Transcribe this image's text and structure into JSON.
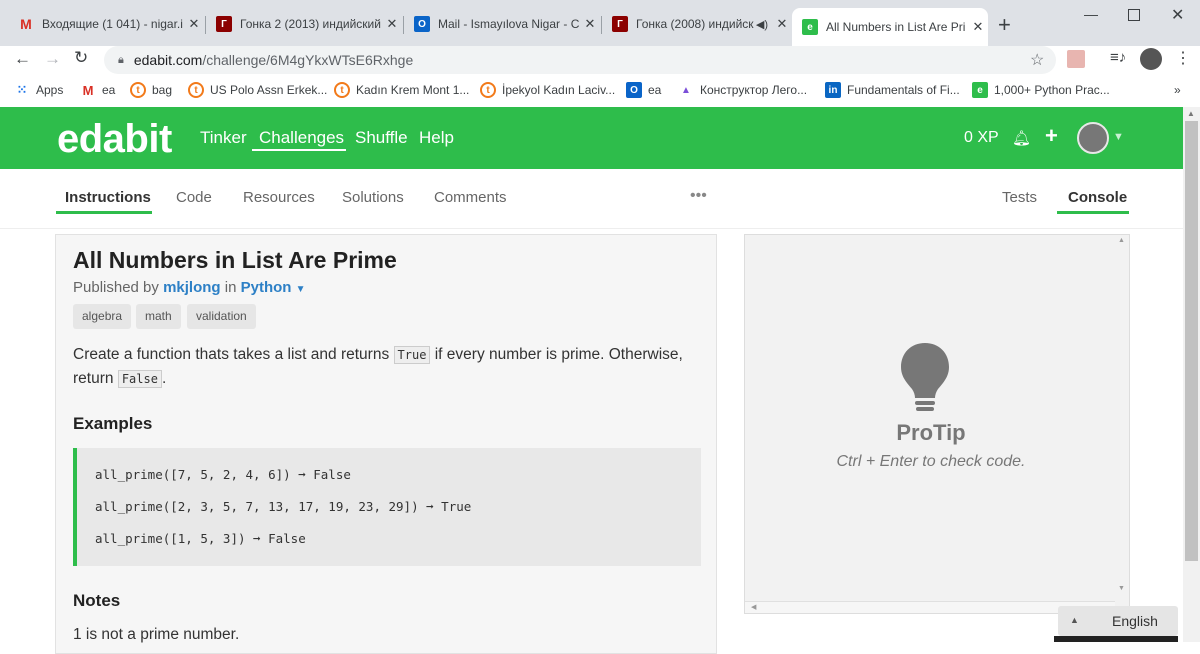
{
  "browser": {
    "tabs": [
      {
        "title": "Входящие (1 041) - nigar.i",
        "icon": "gmail-icon"
      },
      {
        "title": "Гонка 2 (2013) индийский",
        "icon": "movie-icon"
      },
      {
        "title": "Mail - Ismayılova Nigar - C",
        "icon": "outlook-icon"
      },
      {
        "title": "Гонка (2008) индийск",
        "icon": "movie-icon"
      },
      {
        "title": "All Numbers in List Are Pri",
        "icon": "edabit-icon"
      }
    ],
    "url_host": "edabit.com",
    "url_path": "/challenge/6M4gYkxWTsE6Rxhge",
    "bookmarks": [
      "Apps",
      "ea",
      "bag",
      "US Polo Assn Erkek...",
      "Kadın Krem Mont 1...",
      "İpekyol Kadın Laciv...",
      "ea",
      "Конструктор Лего...",
      "Fundamentals of Fi...",
      "1,000+ Python Prac..."
    ],
    "more_bookmarks": "»"
  },
  "site": {
    "logo": "edabit",
    "nav": [
      "Tinker",
      "Challenges",
      "Shuffle",
      "Help"
    ],
    "xp": "0 XP"
  },
  "page_tabs": {
    "left": [
      "Instructions",
      "Code",
      "Resources",
      "Solutions",
      "Comments"
    ],
    "more": "•••",
    "right": [
      "Tests",
      "Console"
    ]
  },
  "challenge": {
    "title": "All Numbers in List Are Prime",
    "published_prefix": "Published by",
    "author": "mkjlong",
    "in_word": "in",
    "language": "Python",
    "tags": [
      "algebra",
      "math",
      "validation"
    ],
    "desc_part1": "Create a function thats takes a list and returns",
    "code_true": "True",
    "desc_part2": "if every number is prime. Otherwise, return",
    "code_false": "False",
    "desc_end": ".",
    "examples_heading": "Examples",
    "examples": [
      "all_prime([7, 5, 2, 4, 6]) ➞ False",
      "all_prime([2, 3, 5, 7, 13, 17, 19, 23, 29]) ➞ True",
      "all_prime([1, 5, 3]) ➞ False"
    ],
    "notes_heading": "Notes",
    "note": "1 is not a prime number."
  },
  "console": {
    "protip_title": "ProTip",
    "protip_text": "Ctrl + Enter to check code."
  },
  "language_selector": "English",
  "colors": {
    "brand": "#2ebd4b",
    "link": "#2d80c6"
  }
}
